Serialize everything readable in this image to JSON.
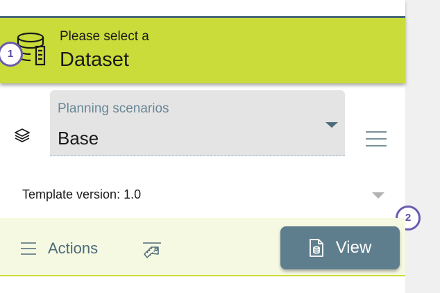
{
  "dataset": {
    "subtitle": "Please select a",
    "title": "Dataset",
    "icon": "database-icon",
    "step": "1",
    "banner_color": "#c9dc3a"
  },
  "planning": {
    "label": "Planning scenarios",
    "value": "Base",
    "layers_icon": "layers-icon",
    "menu_icon": "hamburger-menu-icon"
  },
  "template": {
    "text": "Template version: 1.0"
  },
  "actions": {
    "label": "Actions",
    "tag_icon": "tags-icon",
    "view_label": "View",
    "step": "2"
  },
  "colors": {
    "accent": "#c9dc3a",
    "primary": "#5e7e8d",
    "badge": "#6a5bb0"
  }
}
